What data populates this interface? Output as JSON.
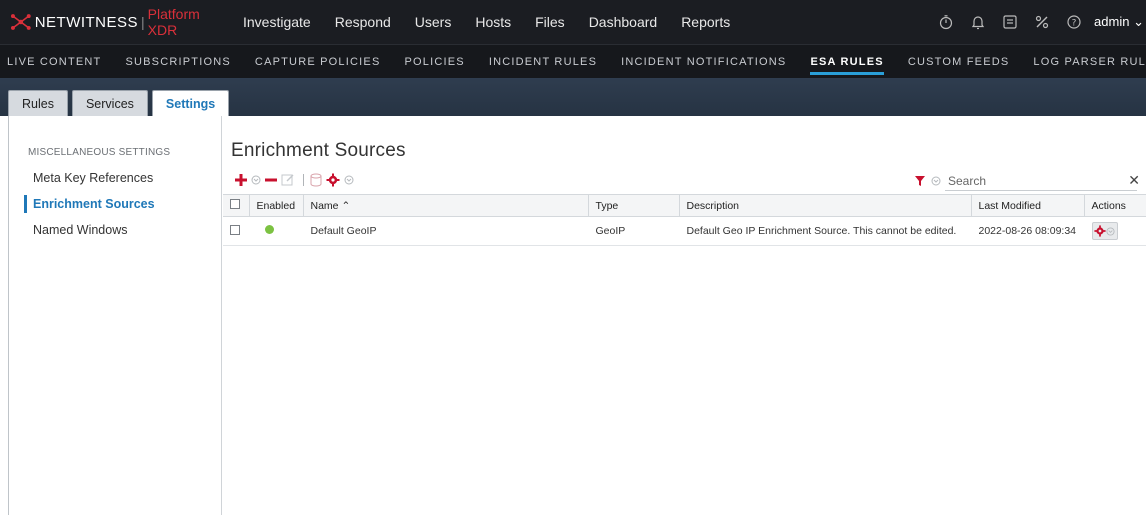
{
  "brand": {
    "name": "NETWITNESS",
    "platform": "Platform XDR"
  },
  "top_nav": [
    "Investigate",
    "Respond",
    "Users",
    "Hosts",
    "Files",
    "Dashboard",
    "Reports"
  ],
  "top_right": {
    "user": "admin"
  },
  "sub_nav": {
    "items": [
      "LIVE CONTENT",
      "SUBSCRIPTIONS",
      "CAPTURE POLICIES",
      "POLICIES",
      "INCIDENT RULES",
      "INCIDENT NOTIFICATIONS",
      "ESA RULES",
      "CUSTOM FEEDS",
      "LOG PARSER RULES"
    ],
    "active": "ESA RULES"
  },
  "tabs": {
    "items": [
      "Rules",
      "Services",
      "Settings"
    ],
    "active": "Settings"
  },
  "sidebar": {
    "section": "MISCELLANEOUS SETTINGS",
    "links": [
      "Meta Key References",
      "Enrichment Sources",
      "Named Windows"
    ],
    "active": "Enrichment Sources"
  },
  "main": {
    "title": "Enrichment Sources",
    "search": {
      "placeholder": "Search"
    }
  },
  "table": {
    "columns": [
      "",
      "Enabled",
      "Name ^",
      "Type",
      "Description",
      "Last Modified",
      "Actions"
    ],
    "rows": [
      {
        "name": "Default GeoIP",
        "type": "GeoIP",
        "description": "Default Geo IP Enrichment Source. This cannot be edited.",
        "last_modified": "2022-08-26 08:09:34",
        "enabled": true
      }
    ]
  },
  "colors": {
    "accent": "#1f78b8",
    "brand_red": "#d9303a",
    "enabled_green": "#7cc242",
    "action_red": "#c8102e"
  }
}
